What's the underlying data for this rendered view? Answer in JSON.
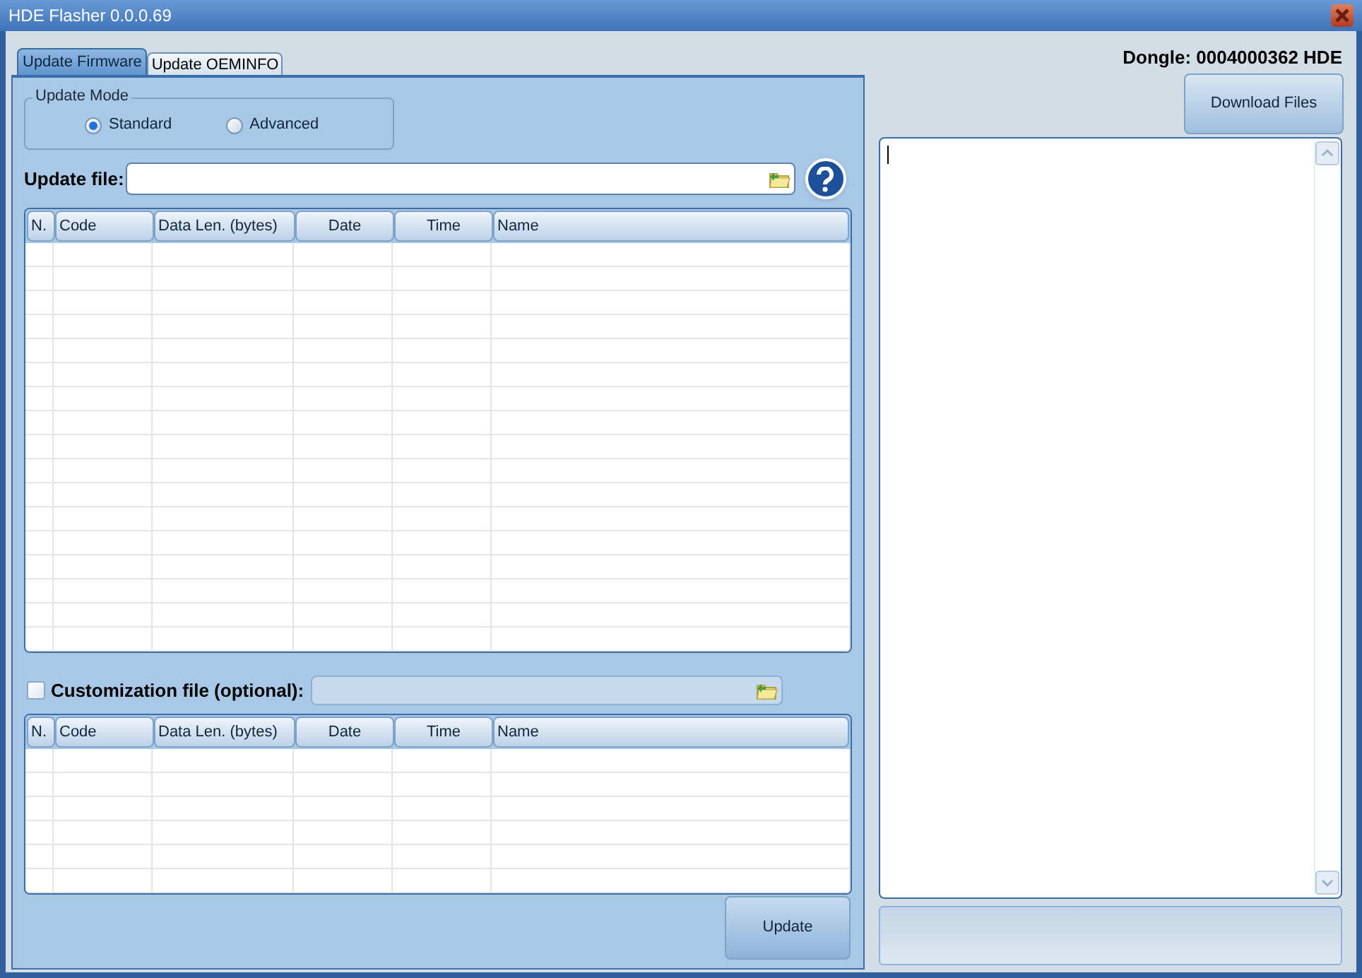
{
  "window": {
    "title": "HDE Flasher 0.0.0.69"
  },
  "tabs": [
    {
      "label": "Update Firmware",
      "selected": true
    },
    {
      "label": "Update OEMINFO",
      "selected": false
    }
  ],
  "update_mode": {
    "title": "Update Mode",
    "options": [
      {
        "label": "Standard",
        "selected": true
      },
      {
        "label": "Advanced",
        "selected": false
      }
    ]
  },
  "update_file": {
    "label": "Update file:"
  },
  "firmware_table": {
    "columns": [
      "N.",
      "Code",
      "Data Len. (bytes)",
      "Date",
      "Time",
      "Name"
    ]
  },
  "customization": {
    "label": "Customization file (optional):",
    "checked": false
  },
  "customization_table": {
    "columns": [
      "N.",
      "Code",
      "Data Len. (bytes)",
      "Date",
      "Time",
      "Name"
    ]
  },
  "update_button": "Update",
  "dongle": "Dongle: 0004000362 HDE",
  "download_button": "Download Files"
}
